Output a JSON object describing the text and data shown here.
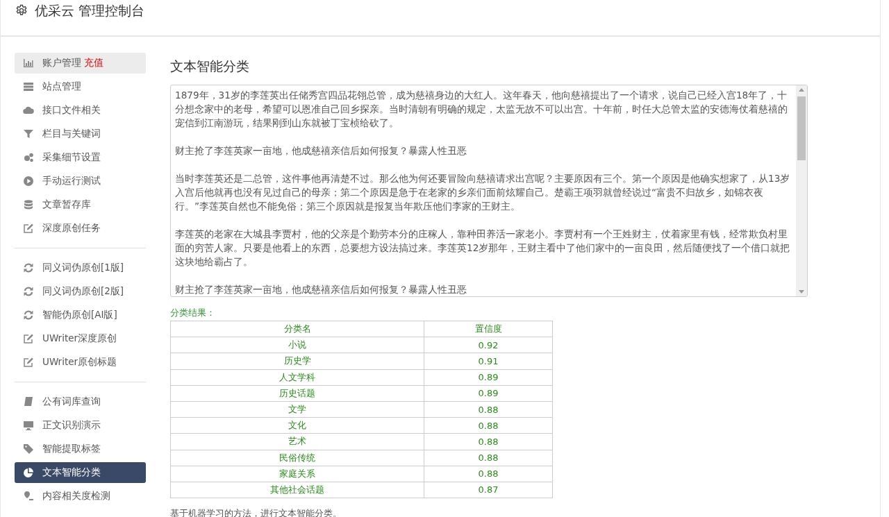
{
  "header": {
    "title": "优采云 管理控制台"
  },
  "sidebar": {
    "groups": [
      {
        "items": [
          {
            "label": "账户管理",
            "badge": "充值",
            "highlighted": true,
            "selected": false
          },
          {
            "label": "站点管理",
            "highlighted": false,
            "selected": false
          },
          {
            "label": "接口文件相关",
            "highlighted": false,
            "selected": false
          },
          {
            "label": "栏目与关键词",
            "highlighted": false,
            "selected": false
          },
          {
            "label": "采集细节设置",
            "highlighted": false,
            "selected": false
          },
          {
            "label": "手动运行测试",
            "highlighted": false,
            "selected": false
          },
          {
            "label": "文章暂存库",
            "highlighted": false,
            "selected": false
          },
          {
            "label": "深度原创任务",
            "highlighted": false,
            "selected": false
          }
        ]
      },
      {
        "items": [
          {
            "label": "同义词伪原创[1版]",
            "highlighted": false,
            "selected": false
          },
          {
            "label": "同义词伪原创[2版]",
            "highlighted": false,
            "selected": false
          },
          {
            "label": "智能伪原创[AI版]",
            "highlighted": false,
            "selected": false
          },
          {
            "label": "UWriter深度原创",
            "highlighted": false,
            "selected": false
          },
          {
            "label": "UWriter原创标题",
            "highlighted": false,
            "selected": false
          }
        ]
      },
      {
        "items": [
          {
            "label": "公有词库查询",
            "highlighted": false,
            "selected": false
          },
          {
            "label": "正文识别演示",
            "highlighted": false,
            "selected": false
          },
          {
            "label": "智能提取标签",
            "highlighted": false,
            "selected": false
          },
          {
            "label": "文本智能分类",
            "highlighted": false,
            "selected": true
          },
          {
            "label": "内容相关度检测",
            "highlighted": false,
            "selected": false
          }
        ]
      }
    ]
  },
  "main": {
    "title": "文本智能分类",
    "text_area": {
      "paragraphs": [
        "1879年，31岁的李莲英出任储秀宫四品花翎总管，成为慈禧身边的大红人。这年春天，他向慈禧提出了一个请求，说自己已经入宫18年了，十分想念家中的老母，希望可以恩准自己回乡探亲。当时清朝有明确的规定，太监无故不可以出宫。十年前，时任大总管太监的安德海仗着慈禧的宠信到江南游玩，结果刚到山东就被丁宝桢给砍了。",
        "财主抢了李莲英家一亩地，他成慈禧亲信后如何报复？暴露人性丑恶",
        "当时李莲英还是二总管，这件事他再清楚不过。那么他为何还要冒险向慈禧请求出宫呢？主要原因有三个。第一个原因是他确实想家了，从13岁入宫后他就再也没有见过自己的母亲；第二个原因是急于在老家的乡亲们面前炫耀自己。楚霸王项羽就曾经说过“富贵不归故乡，如锦衣夜行。”李莲英自然也不能免俗；第三个原因就是报复当年欺压他们李家的王财主。",
        "李莲英的老家在大城县李贾村，他的父亲是个勤劳本分的庄稼人，靠种田养活一家老小。李贾村有一个王姓财主，仗着家里有钱，经常欺负村里面的穷苦人家。只要是他看上的东西，总要想方设法搞过来。李莲英12岁那年，王财主看中了他们家中的一亩良田，然后随便找了一个借口就把这块地给霸占了。",
        "财主抢了李莲英家一亩地，他成慈禧亲信后如何报复？暴露人性丑恶"
      ]
    },
    "result_label": "分类结果：",
    "table": {
      "columns": [
        "分类名",
        "置信度"
      ],
      "rows": [
        [
          "小说",
          "0.92"
        ],
        [
          "历史学",
          "0.91"
        ],
        [
          "人文学科",
          "0.89"
        ],
        [
          "历史话题",
          "0.89"
        ],
        [
          "文学",
          "0.88"
        ],
        [
          "文化",
          "0.88"
        ],
        [
          "艺术",
          "0.88"
        ],
        [
          "民俗传统",
          "0.88"
        ],
        [
          "家庭关系",
          "0.88"
        ],
        [
          "其他社会话题",
          "0.87"
        ]
      ]
    },
    "description": "基于机器学习的方法，进行文本智能分类。"
  }
}
